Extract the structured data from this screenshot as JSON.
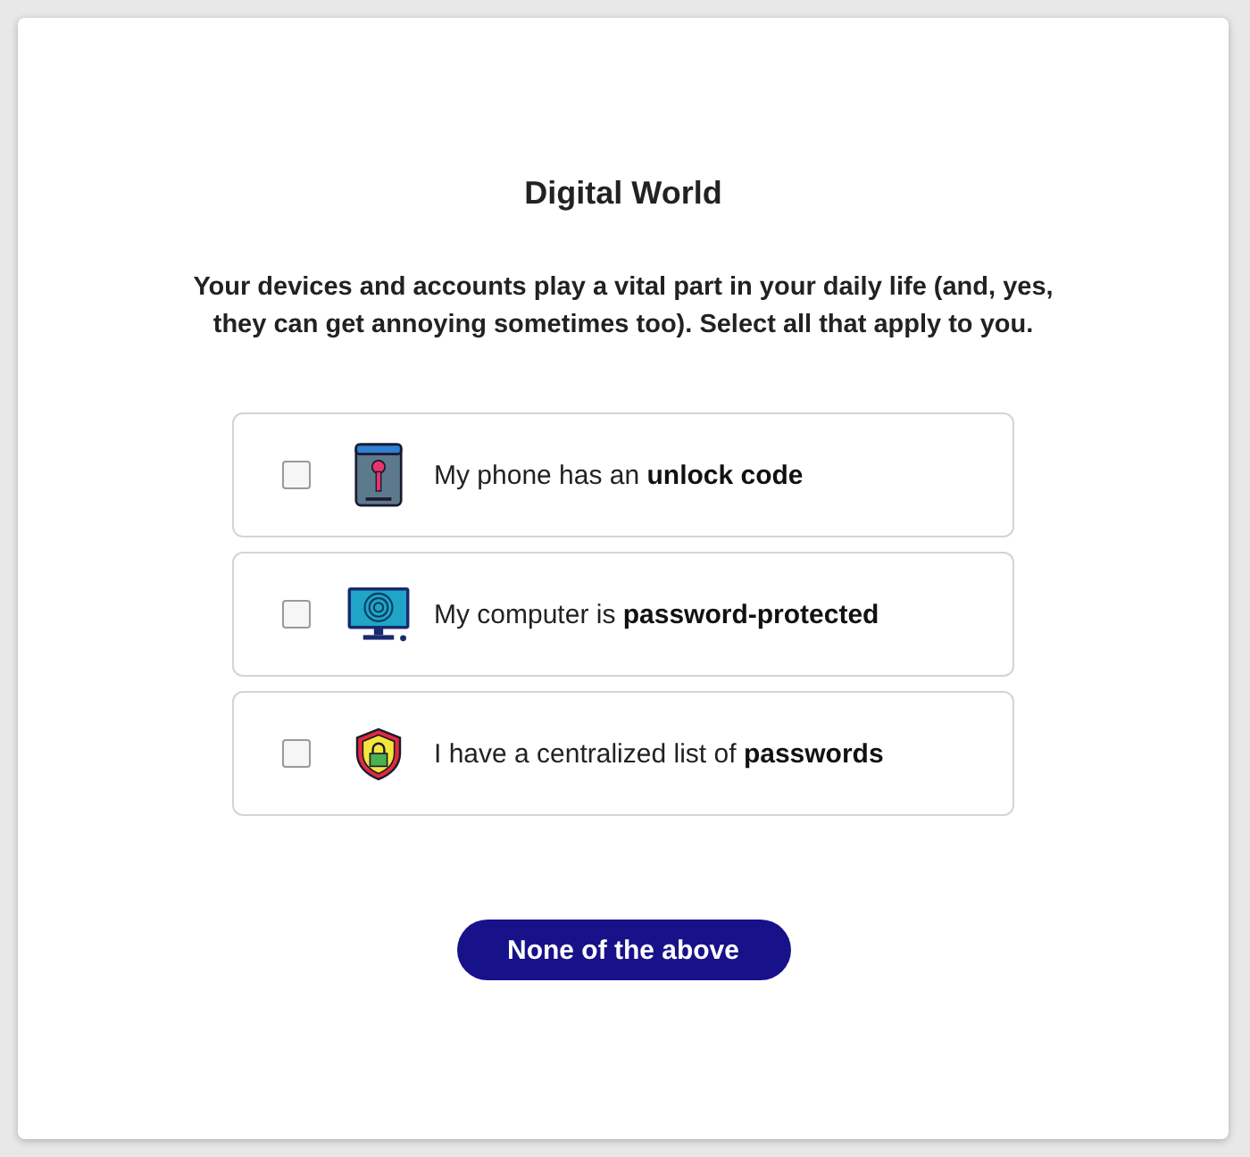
{
  "title": "Digital World",
  "intro": "Your devices and accounts play a vital part in your daily life (and, yes, they can get annoying sometimes too). Select all that apply to you.",
  "options": [
    {
      "kind": "phone",
      "label": "My phone has an **unlock code**",
      "checked": false
    },
    {
      "kind": "computer",
      "label": "My computer is **password-protected**",
      "checked": false
    },
    {
      "kind": "shield",
      "label": "I have a centralized list of **passwords**",
      "checked": false
    }
  ],
  "button": "None of the above"
}
